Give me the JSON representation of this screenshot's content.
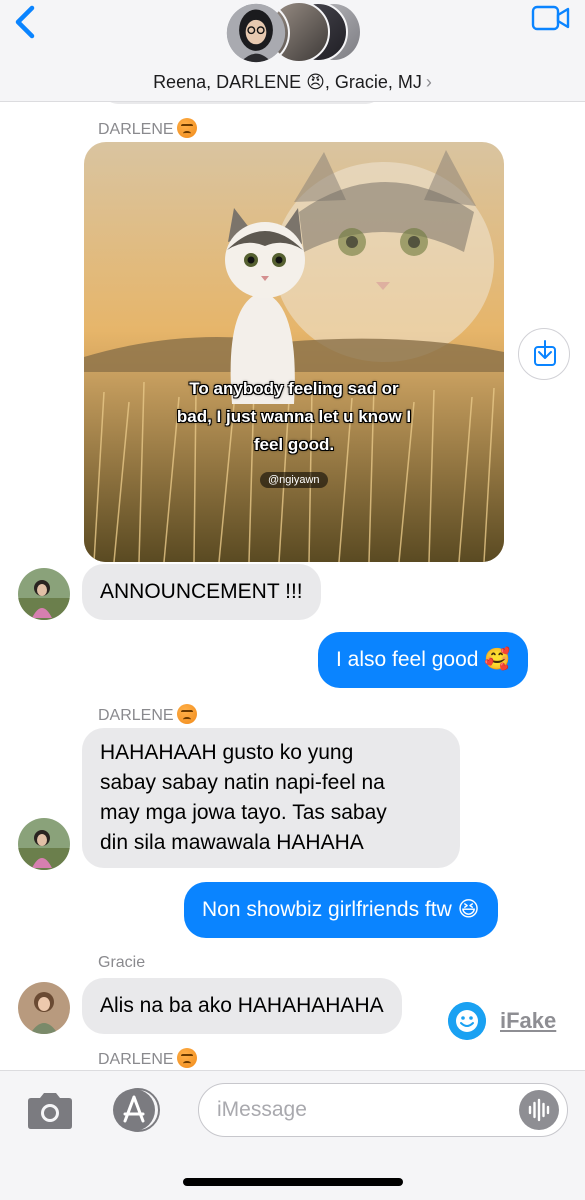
{
  "header": {
    "group_name": "Reena, DARLENE 😠, Gracie, MJ",
    "chevron": "›",
    "back_icon": "chevron-left-icon",
    "video_icon": "video-camera-icon"
  },
  "colors": {
    "accent": "#0a84ff",
    "incoming_bubble": "#e9e9eb",
    "sender_gray": "#8a8a8e"
  },
  "messages": {
    "sender_darlene": "DARLENE",
    "image_caption_lines": [
      "To anybody feeling sad or",
      "bad, I just wanna let u know I",
      "feel good."
    ],
    "image_watermark": "@ngiyawn",
    "announcement": "ANNOUNCEMENT !!!",
    "reply_1": "I also feel good 🥰",
    "sender_darlene_2": "DARLENE",
    "long_msg_lines": [
      "HAHAHAAH gusto ko yung",
      "sabay sabay natin napi-feel na",
      "may mga jowa tayo. Tas sabay",
      "din sila mawawala HAHAHA"
    ],
    "reply_2": "Non showbiz girlfriends ftw 😆",
    "sender_gracie": "Gracie",
    "gracie_msg": "Alis na ba ako HAHAHAHAHA",
    "sender_darlene_3": "DARLENE"
  },
  "watermark": {
    "label": "iFake"
  },
  "input_bar": {
    "placeholder": "iMessage",
    "camera_icon": "camera-icon",
    "appstore_icon": "app-store-icon",
    "audio_icon": "audio-waveform-icon"
  }
}
